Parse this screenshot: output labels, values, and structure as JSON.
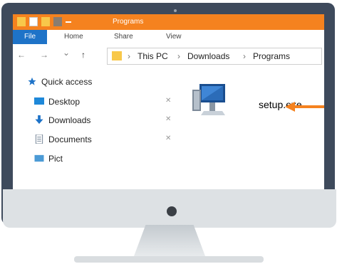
{
  "window": {
    "title": "Programs",
    "tabs": [
      "File",
      "Home",
      "Share",
      "View"
    ]
  },
  "address": {
    "crumbs": [
      "This PC",
      "Downloads",
      "Programs"
    ],
    "separator": "›"
  },
  "nav": {
    "back": "←",
    "forward": "→",
    "recent": "⌄",
    "up": "↑"
  },
  "sidebar": {
    "items": [
      {
        "label": "Quick access",
        "icon": "star-icon"
      },
      {
        "label": "Desktop",
        "icon": "desktop-icon"
      },
      {
        "label": "Downloads",
        "icon": "download-icon"
      },
      {
        "label": "Documents",
        "icon": "document-icon"
      },
      {
        "label": "Pict",
        "icon": "pictures-icon"
      }
    ],
    "pin": "📌"
  },
  "file": {
    "name": "setup.exe",
    "icon": "computer-icon"
  },
  "annotation": {
    "icon": "arrow-icon",
    "color": "#f5821f"
  },
  "colors": {
    "titlebar": "#f5821f",
    "file_tab": "#1e73c8",
    "monitor": "#3e4a5c"
  }
}
